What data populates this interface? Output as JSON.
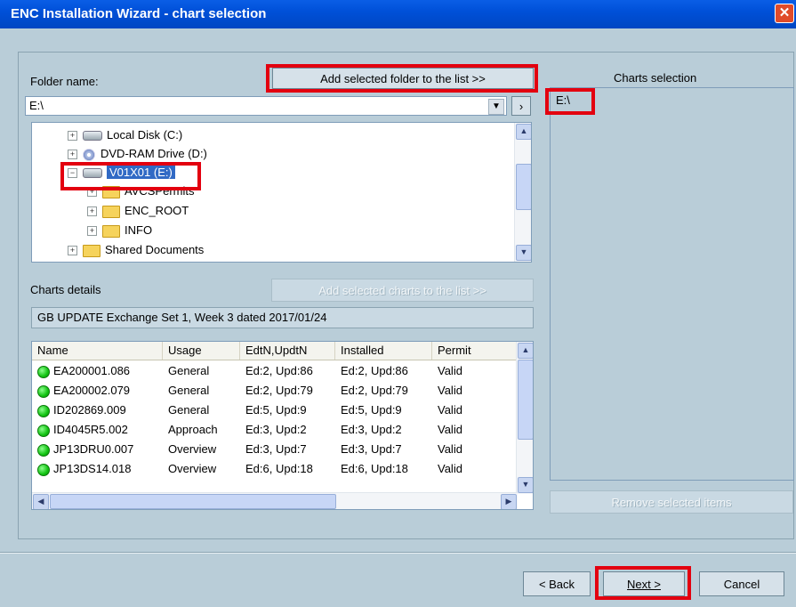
{
  "window": {
    "title": "ENC Installation Wizard - chart selection",
    "close_glyph": "✕"
  },
  "folder": {
    "label": "Folder name:",
    "add_folder_button": "Add selected folder to the list >>",
    "path_value": "E:\\",
    "go_glyph": "›",
    "dropdown_glyph": "▼"
  },
  "tree": {
    "items": [
      {
        "label": "Local Disk (C:)",
        "icon": "hard-drive-icon"
      },
      {
        "label": "DVD-RAM Drive (D:)",
        "icon": "cd-drive-icon"
      },
      {
        "label": "V01X01 (E:)",
        "icon": "hard-drive-icon",
        "selected": true
      },
      {
        "label": "AVCSPermits",
        "icon": "folder-icon"
      },
      {
        "label": "ENC_ROOT",
        "icon": "folder-icon"
      },
      {
        "label": "INFO",
        "icon": "folder-icon"
      },
      {
        "label": "Shared Documents",
        "icon": "folder-icon"
      }
    ]
  },
  "charts_selection": {
    "label": "Charts selection",
    "items": [
      "E:\\"
    ],
    "remove_button": "Remove selected items"
  },
  "charts_details": {
    "label": "Charts details",
    "add_charts_button": "Add selected charts to the list >>",
    "info_text": "GB UPDATE Exchange Set 1, Week 3 dated 2017/01/24",
    "columns": [
      "Name",
      "Usage",
      "EdtN,UpdtN",
      "Installed",
      "Permit"
    ],
    "rows": [
      {
        "name": "EA200001.086",
        "usage": "General",
        "edtn": "Ed:2, Upd:86",
        "installed": "Ed:2, Upd:86",
        "permit": "Valid"
      },
      {
        "name": "EA200002.079",
        "usage": "General",
        "edtn": "Ed:2, Upd:79",
        "installed": "Ed:2, Upd:79",
        "permit": "Valid"
      },
      {
        "name": "ID202869.009",
        "usage": "General",
        "edtn": "Ed:5, Upd:9",
        "installed": "Ed:5, Upd:9",
        "permit": "Valid"
      },
      {
        "name": "ID4045R5.002",
        "usage": "Approach",
        "edtn": "Ed:3, Upd:2",
        "installed": "Ed:3, Upd:2",
        "permit": "Valid"
      },
      {
        "name": "JP13DRU0.007",
        "usage": "Overview",
        "edtn": "Ed:3, Upd:7",
        "installed": "Ed:3, Upd:7",
        "permit": "Valid"
      },
      {
        "name": "JP13DS14.018",
        "usage": "Overview",
        "edtn": "Ed:6, Upd:18",
        "installed": "Ed:6, Upd:18",
        "permit": "Valid"
      }
    ]
  },
  "footer": {
    "back_button": "< Back",
    "next_button": "Next >",
    "cancel_button": "Cancel"
  },
  "colors": {
    "highlight": "#e3000f",
    "title_bar": "#0050d8",
    "panel_bg": "#b9cdd8",
    "status_ok": "#12c312"
  }
}
